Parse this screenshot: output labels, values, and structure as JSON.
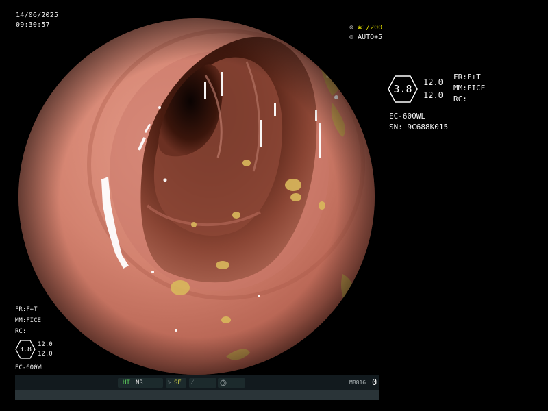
{
  "header": {
    "date": "14/06/2025",
    "time": "09:30:57"
  },
  "indicators": {
    "shutter_prefix": "⊗",
    "shutter_star": "✱",
    "shutter": "1/200",
    "iris_prefix": "⚙",
    "iris": "AUTO+5"
  },
  "info_panel": {
    "hex_value": "3.8",
    "values": [
      "12.0",
      "12.0"
    ],
    "settings": [
      "FR:F+T",
      "MM:FICE",
      "RC:"
    ],
    "scope_model": "EC-600WL",
    "serial": "SN: 9C688K015"
  },
  "bottom_left": {
    "settings": [
      "FR:F+T",
      "MM:FICE",
      "RC:"
    ],
    "hex_value": "3.8",
    "values": [
      "12.0",
      "12.0"
    ],
    "scope_model": "EC-600WL"
  },
  "status_bar": {
    "ht": "HT",
    "nr": "NR",
    "se": "SE",
    "mb": "MB816",
    "counter": "0"
  },
  "colors": {
    "accent": "#e6e000",
    "status_green": "#5ed65e",
    "mucosa": "#c9766a"
  }
}
